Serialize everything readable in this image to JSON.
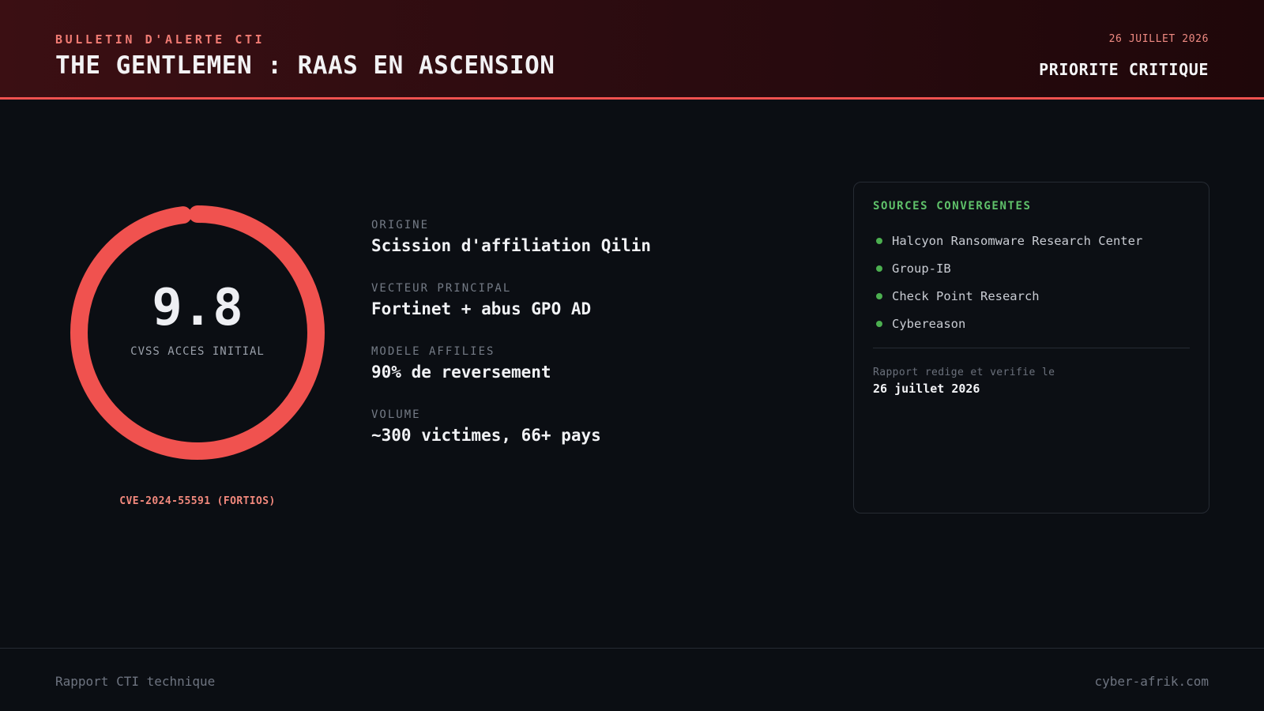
{
  "header": {
    "kicker": "BULLETIN D'ALERTE CTI",
    "title": "THE GENTLEMEN : RAAS EN ASCENSION",
    "date": "26 JUILLET 2026",
    "priority": "PRIORITE CRITIQUE"
  },
  "score": {
    "value": "9.8",
    "max": 10,
    "label": "CVSS ACCES INITIAL",
    "cve": "CVE-2024-55591 (FORTIOS)",
    "ring_color": "#f0524f"
  },
  "facts": [
    {
      "label": "ORIGINE",
      "value": "Scission d'affiliation Qilin"
    },
    {
      "label": "VECTEUR PRINCIPAL",
      "value": "Fortinet + abus GPO AD"
    },
    {
      "label": "MODELE AFFILIES",
      "value": "90% de reversement"
    },
    {
      "label": "VOLUME",
      "value": "~300 victimes, 66+ pays"
    }
  ],
  "sources": {
    "title": "SOURCES CONVERGENTES",
    "items": [
      "Halcyon Ransomware Research Center",
      "Group-IB",
      "Check Point Research",
      "Cybereason"
    ],
    "verified_label": "Rapport redige et verifie le",
    "verified_date": "26 juillet 2026",
    "dot_color": "#4caf50"
  },
  "footer": {
    "left": "Rapport CTI technique",
    "right": "cyber-afrik.com"
  },
  "colors": {
    "accent": "#f0524f",
    "source_green": "#5fc16a"
  }
}
